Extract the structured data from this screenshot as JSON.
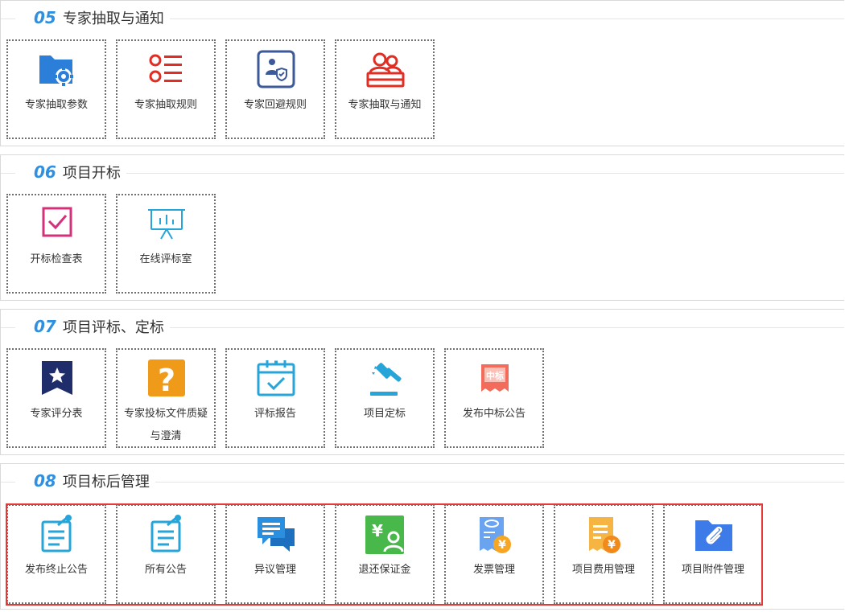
{
  "sections": [
    {
      "num": "05",
      "title": "专家抽取与通知",
      "items": [
        {
          "label": "专家抽取参数",
          "icon": "folder-gear-icon"
        },
        {
          "label": "专家抽取规则",
          "icon": "list-icon"
        },
        {
          "label": "专家回避规则",
          "icon": "person-shield-icon"
        },
        {
          "label": "专家抽取与通知",
          "icon": "people-icon"
        }
      ]
    },
    {
      "num": "06",
      "title": "项目开标",
      "items": [
        {
          "label": "开标检查表",
          "icon": "checkbox-icon"
        },
        {
          "label": "在线评标室",
          "icon": "presentation-board-icon"
        }
      ]
    },
    {
      "num": "07",
      "title": "项目评标、定标",
      "items": [
        {
          "label": "专家评分表",
          "icon": "star-bookmark-icon"
        },
        {
          "label": "专家投标文件质疑与澄清",
          "icon": "question-icon"
        },
        {
          "label": "评标报告",
          "icon": "calendar-check-icon"
        },
        {
          "label": "项目定标",
          "icon": "gavel-icon"
        },
        {
          "label": "发布中标公告",
          "icon": "award-ribbon-icon",
          "badge": "中标"
        }
      ]
    },
    {
      "num": "08",
      "title": "项目标后管理",
      "items": [
        {
          "label": "发布终止公告",
          "icon": "notice-edit-icon"
        },
        {
          "label": "所有公告",
          "icon": "notice-list-icon"
        },
        {
          "label": "异议管理",
          "icon": "chat-bubbles-icon"
        },
        {
          "label": "退还保证金",
          "icon": "deposit-yen-icon"
        },
        {
          "label": "发票管理",
          "icon": "invoice-icon"
        },
        {
          "label": "项目费用管理",
          "icon": "fee-receipt-icon"
        },
        {
          "label": "项目附件管理",
          "icon": "attachment-folder-icon"
        }
      ]
    }
  ],
  "colors": {
    "accent": "#2f8fe0",
    "highlight": "#e53935",
    "blue": "#2b7fd9",
    "red": "#e02e24",
    "navy": "#3c5a99",
    "pink": "#d4317b",
    "cyan": "#27a4d8",
    "dark_navy": "#1f2d6b",
    "orange": "#f09a1a",
    "green": "#49b84a",
    "gold": "#f6a623",
    "royal_blue": "#3d7be8"
  }
}
